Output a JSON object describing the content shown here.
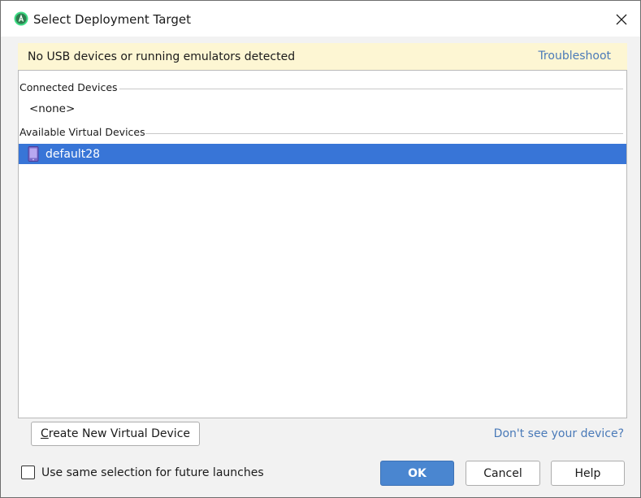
{
  "window": {
    "title": "Select Deployment Target",
    "app_icon": "android-studio-icon",
    "close_icon": "close-icon"
  },
  "banner": {
    "message": "No USB devices or running emulators detected",
    "link": "Troubleshoot",
    "background": "#fdf6d3",
    "link_color": "#4a7ab8"
  },
  "device_list": {
    "connected": {
      "header": "Connected Devices",
      "empty_text": "<none>"
    },
    "available": {
      "header": "Available Virtual Devices",
      "devices": [
        {
          "name": "default28",
          "icon": "phone-icon",
          "selected": true
        }
      ]
    },
    "selection_color": "#3875d7"
  },
  "actions": {
    "create_button": "Create New Virtual Device",
    "dont_see_link": "Don't see your device?",
    "checkbox_label": "Use same selection for future launches",
    "checkbox_checked": false,
    "ok_button": "OK",
    "cancel_button": "Cancel",
    "help_button": "Help",
    "ok_color": "#4a86d0"
  }
}
